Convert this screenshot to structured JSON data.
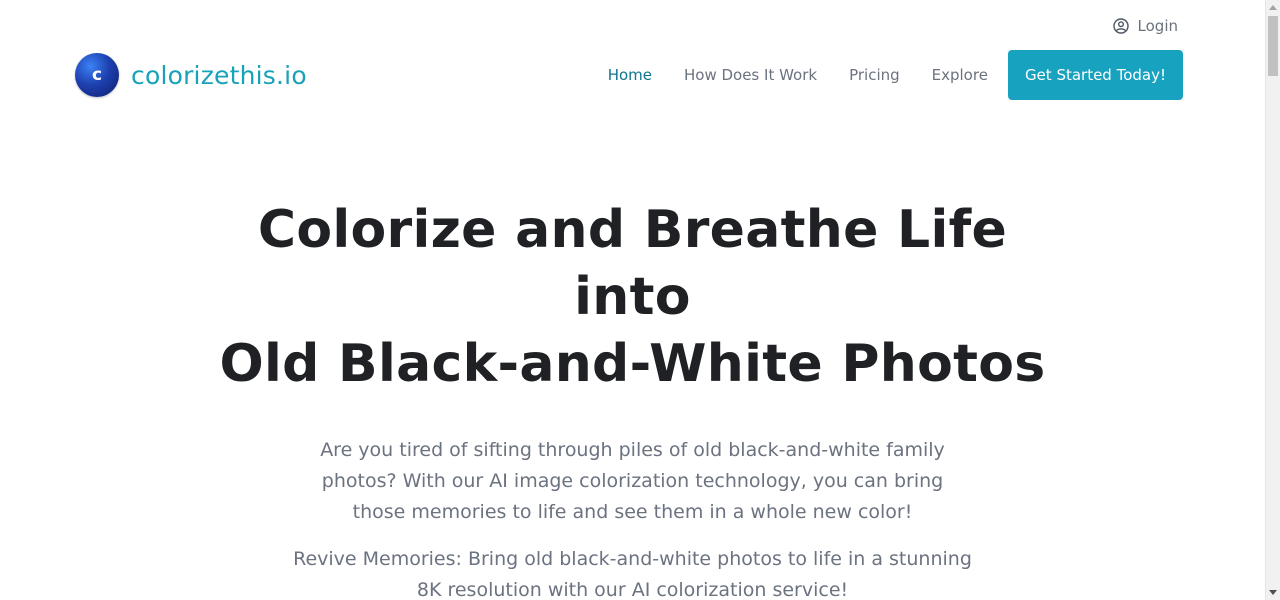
{
  "topbar": {
    "login_label": "Login",
    "login_icon": "user-circle-icon"
  },
  "brand": {
    "logo_letter": "c",
    "name": "colorizethis.io",
    "color": "#17a2b8"
  },
  "nav": {
    "items": [
      {
        "label": "Home",
        "active": true
      },
      {
        "label": "How Does It Work",
        "active": false
      },
      {
        "label": "Pricing",
        "active": false
      },
      {
        "label": "Explore",
        "active": false
      }
    ],
    "cta_label": "Get Started Today!",
    "cta_color": "#17a2c0"
  },
  "hero": {
    "title_line1": "Colorize and Breathe Life into",
    "title_line2": "Old Black-and-White Photos",
    "lead": "Are you tired of sifting through piles of old black-and-white family photos? With our AI image colorization technology, you can bring those memories to life and see them in a whole new color!",
    "sub": "Revive Memories: Bring old black-and-white photos to life in a stunning 8K resolution with our AI colorization service!"
  }
}
